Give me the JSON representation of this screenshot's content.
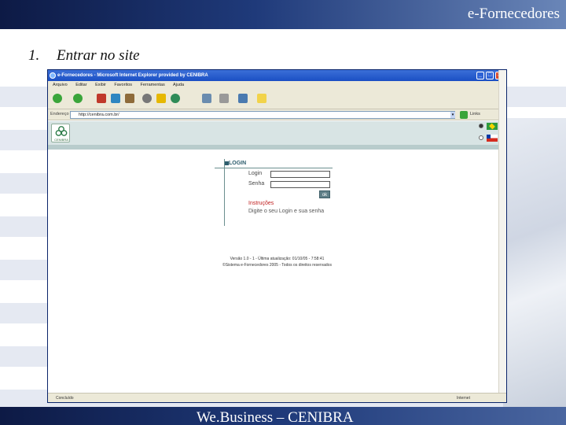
{
  "slide": {
    "header_title": "e-Fornecedores",
    "step_number": "1.",
    "step_text": "Entrar no site",
    "footer_text": "We.Business – CENIBRA"
  },
  "browser": {
    "title": "e-Fornecedores - Microsoft Internet Explorer provided by CENIBRA",
    "menu": [
      "Arquivo",
      "Editar",
      "Exibir",
      "Favoritos",
      "Ferramentas",
      "Ajuda"
    ],
    "address_label": "Endereço",
    "address_value": "http://cenibra.com.br/",
    "links_label": "Links",
    "status_text": "Concluído",
    "status_zone": "Internet"
  },
  "page": {
    "logo_text": "CENIBRA",
    "login_title": "LOGIN",
    "login_label": "Login",
    "password_label": "Senha",
    "ok_label": "ok",
    "instructions_title": "Instruções",
    "instructions_text": "Digite o seu Login e sua senha",
    "version_line": "Versão 1.0 - 1 - Última atualização: 01/10/05 - 7:58:41",
    "copyright_line": "©Sistema e-Fornecedores 2005 - Todos os direitos reservados"
  },
  "colors": {
    "header_bar": "#1f3a7a",
    "page_header": "#d8e4e4",
    "instructions": "#c02020"
  }
}
